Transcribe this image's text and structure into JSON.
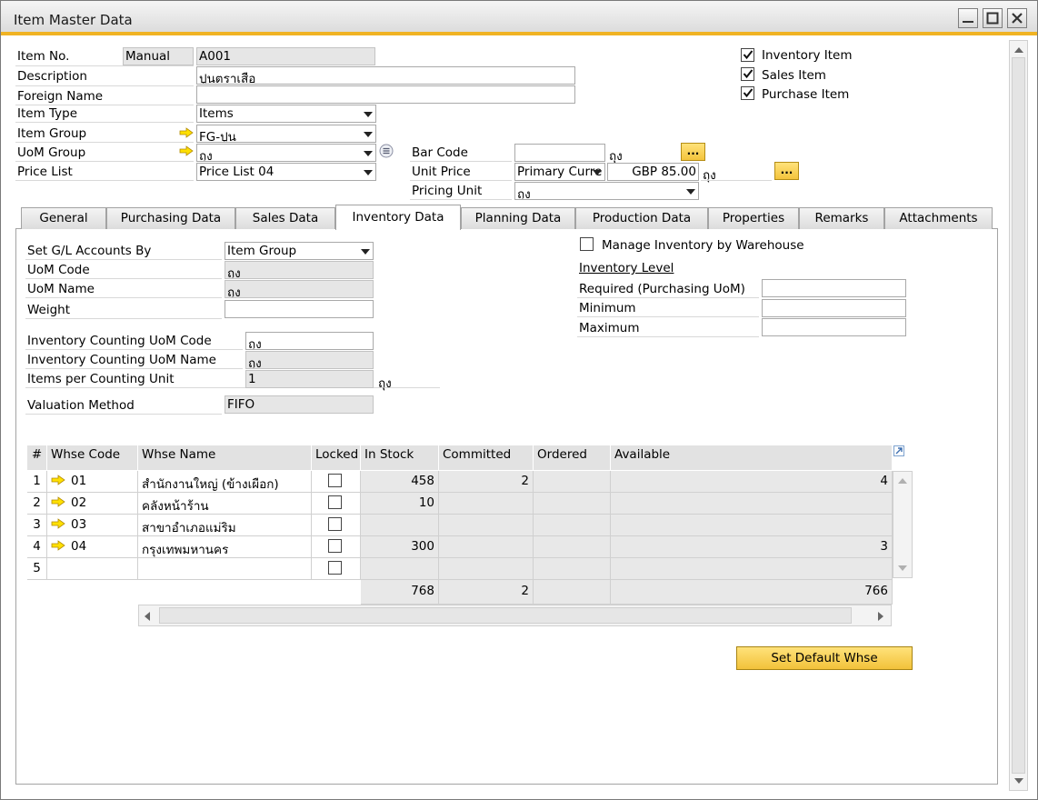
{
  "window": {
    "title": "Item Master Data"
  },
  "header": {
    "item_no_label": "Item No.",
    "item_no_series": "Manual",
    "item_no_value": "A001",
    "description_label": "Description",
    "description_value": "ปูนตราเสือ",
    "foreign_name_label": "Foreign Name",
    "foreign_name_value": "",
    "item_type_label": "Item Type",
    "item_type_value": "Items",
    "item_group_label": "Item Group",
    "item_group_value": "FG-ปูน",
    "uom_group_label": "UoM Group",
    "uom_group_value": "ถุง",
    "price_list_label": "Price List",
    "price_list_value": "Price List 04",
    "bar_code_label": "Bar Code",
    "bar_code_value": "",
    "bar_code_uom": "ถุง",
    "unit_price_label": "Unit Price",
    "unit_price_currency": "Primary Curre",
    "unit_price_value": "GBP 85.00",
    "unit_price_uom": "ถุง",
    "pricing_unit_label": "Pricing Unit",
    "pricing_unit_value": "ถุง",
    "dots": "...",
    "inventory_item_label": "Inventory Item",
    "sales_item_label": "Sales Item",
    "purchase_item_label": "Purchase Item"
  },
  "tabs": [
    "General",
    "Purchasing Data",
    "Sales Data",
    "Inventory Data",
    "Planning Data",
    "Production Data",
    "Properties",
    "Remarks",
    "Attachments"
  ],
  "inventory": {
    "gl_label": "Set G/L Accounts By",
    "gl_value": "Item Group",
    "uom_code_label": "UoM Code",
    "uom_code_value": "ถุง",
    "uom_name_label": "UoM Name",
    "uom_name_value": "ถุง",
    "weight_label": "Weight",
    "weight_value": "",
    "count_code_label": "Inventory Counting UoM Code",
    "count_code_value": "ถุง",
    "count_name_label": "Inventory Counting UoM Name",
    "count_name_value": "ถุง",
    "items_per_label": "Items per Counting Unit",
    "items_per_value": "1",
    "items_per_uom": "ถุง",
    "valuation_label": "Valuation Method",
    "valuation_value": "FIFO",
    "manage_label": "Manage Inventory by Warehouse",
    "level_label": "Inventory Level",
    "required_label": "Required (Purchasing UoM)",
    "minimum_label": "Minimum",
    "maximum_label": "Maximum",
    "required_value": "",
    "minimum_value": "",
    "maximum_value": ""
  },
  "grid": {
    "headers": [
      "#",
      "Whse Code",
      "Whse Name",
      "Locked",
      "In Stock",
      "Committed",
      "Ordered",
      "Available"
    ],
    "rows": [
      {
        "n": "1",
        "code": "01",
        "name": "สำนักงานใหญ่ (ข้างเผือก)",
        "stock": "458",
        "committed": "2",
        "ordered": "",
        "available": "4"
      },
      {
        "n": "2",
        "code": "02",
        "name": "คลังหน้าร้าน",
        "stock": "10",
        "committed": "",
        "ordered": "",
        "available": ""
      },
      {
        "n": "3",
        "code": "03",
        "name": "สาขาอำเภอแม่ริม",
        "stock": "",
        "committed": "",
        "ordered": "",
        "available": ""
      },
      {
        "n": "4",
        "code": "04",
        "name": "กรุงเทพมหานคร",
        "stock": "300",
        "committed": "",
        "ordered": "",
        "available": "3"
      },
      {
        "n": "5",
        "code": "",
        "name": "",
        "stock": "",
        "committed": "",
        "ordered": "",
        "available": ""
      }
    ],
    "totals": {
      "stock": "768",
      "committed": "2",
      "ordered": "",
      "available": "766"
    }
  },
  "buttons": {
    "set_default_whse": "Set Default Whse"
  },
  "colors": {
    "accent": "#f0b323",
    "button": "#f4c43c"
  }
}
